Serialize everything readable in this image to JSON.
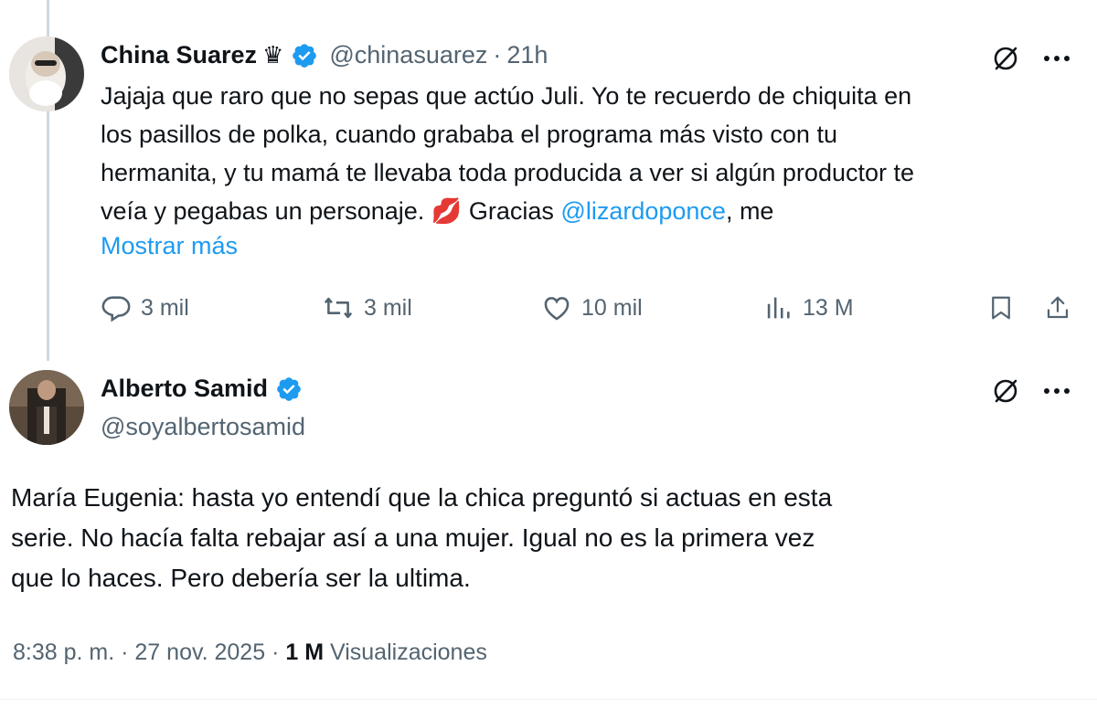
{
  "tweet1": {
    "name": "China Suarez",
    "handle": "@chinasuarez",
    "separator": "·",
    "time": "21h",
    "text_line1": "Jajaja que raro que no sepas que actúo Juli. Yo te recuerdo de chiquita en",
    "text_line2": "los pasillos de polka, cuando grababa el programa más visto con tu",
    "text_line3": "hermanita, y tu mamá te llevaba toda producida a ver si algún productor te",
    "text_line4_a": "veía y pegabas un personaje. ",
    "text_line4_emoji": "💋",
    "text_line4_b": " Gracias ",
    "mention": "@lizardoponce",
    "text_line4_c": ", me",
    "show_more": "Mostrar más",
    "replies": "3 mil",
    "reposts": "3 mil",
    "likes": "10 mil",
    "views": "13 M"
  },
  "tweet2": {
    "name": "Alberto Samid",
    "handle": "@soyalbertosamid",
    "text_line1": "María Eugenia: hasta yo entendí que la chica preguntó si actuas en esta",
    "text_line2": "serie. No hacía falta rebajar así a una mujer. Igual no es la primera vez",
    "text_line3": "que lo haces. Pero debería ser la ultima.",
    "time": "8:38 p. m.",
    "date": "27 nov. 2025",
    "separator": "·",
    "views_count": "1 M",
    "views_label": "Visualizaciones"
  },
  "colors": {
    "accent": "#1d9bf0",
    "secondary_text": "#536471",
    "primary_text": "#0f1419"
  },
  "icons": [
    "verified-icon",
    "crown-icon",
    "grok-icon",
    "more-icon",
    "reply-icon",
    "repost-icon",
    "like-icon",
    "views-icon",
    "bookmark-icon",
    "share-icon"
  ]
}
